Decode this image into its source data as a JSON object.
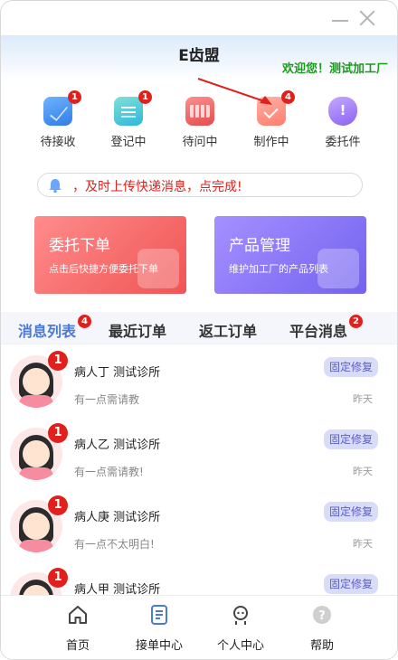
{
  "app": {
    "title": "E齿盟",
    "welcome": "欢迎您！测试加工厂"
  },
  "status_items": [
    {
      "label": "待接收",
      "badge": "1",
      "icon": "envelope-icon"
    },
    {
      "label": "登记中",
      "badge": "1",
      "icon": "register-icon"
    },
    {
      "label": "待问中",
      "badge": "",
      "icon": "inquiry-icon"
    },
    {
      "label": "制作中",
      "badge": "4",
      "icon": "making-icon"
    },
    {
      "label": "委托件",
      "badge": "",
      "icon": "entrust-icon"
    }
  ],
  "notice": {
    "text": "，及时上传快递消息，点完成!",
    "icon": "bell-icon"
  },
  "cards": [
    {
      "title": "委托下单",
      "subtitle": "点击后快捷方便委托下单"
    },
    {
      "title": "产品管理",
      "subtitle": "维护加工厂的产品列表"
    }
  ],
  "tabs": [
    {
      "label": "消息列表",
      "badge": "4"
    },
    {
      "label": "最近订单",
      "badge": ""
    },
    {
      "label": "返工订单",
      "badge": ""
    },
    {
      "label": "平台消息",
      "badge": "2"
    }
  ],
  "messages": [
    {
      "title": "病人丁 测试诊所",
      "message": "有一点需请教",
      "tag": "固定修复",
      "time": "昨天",
      "badge": "1"
    },
    {
      "title": "病人乙 测试诊所",
      "message": "有一点需请教!",
      "tag": "固定修复",
      "time": "昨天",
      "badge": "1"
    },
    {
      "title": "病人庚 测试诊所",
      "message": "有一点不太明白!",
      "tag": "固定修复",
      "time": "昨天",
      "badge": "1"
    },
    {
      "title": "病人甲 测试诊所",
      "message": "",
      "tag": "固定修复",
      "time": "",
      "badge": "1"
    }
  ],
  "tabbar": [
    {
      "label": "首页",
      "icon": "home-icon"
    },
    {
      "label": "接单中心",
      "icon": "order-center-icon"
    },
    {
      "label": "个人中心",
      "icon": "person-icon"
    },
    {
      "label": "帮助",
      "icon": "help-icon"
    }
  ],
  "colors": {
    "accent_blue": "#4a79d8",
    "welcome_green": "#1b9a1b",
    "badge_red": "#e0201c",
    "notice_red": "#e0201c"
  }
}
